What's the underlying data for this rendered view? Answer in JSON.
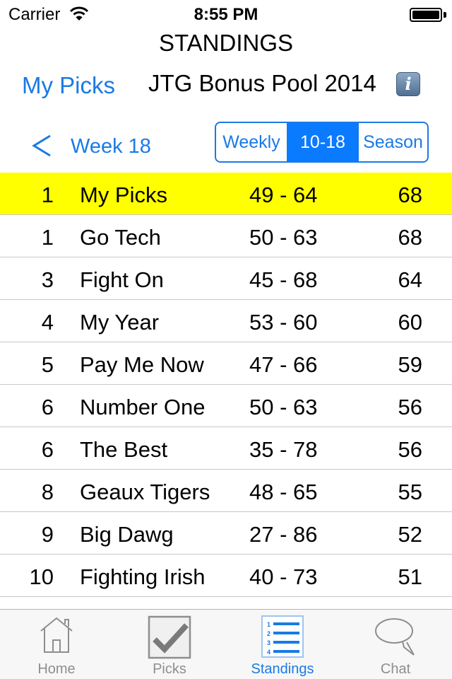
{
  "status_bar": {
    "carrier": "Carrier",
    "time": "8:55 PM",
    "wifi_icon": "wifi-icon",
    "battery_icon": "battery-full-icon"
  },
  "header": {
    "title": "STANDINGS",
    "my_picks_label": "My Picks",
    "pool_name": "JTG Bonus Pool 2014",
    "info_icon": "info-icon"
  },
  "week_nav": {
    "back_icon": "chevron-left-icon",
    "week_label": "Week 18"
  },
  "segmented_control": {
    "segments": [
      {
        "label": "Weekly",
        "selected": false
      },
      {
        "label": "10-18",
        "selected": true
      },
      {
        "label": "Season",
        "selected": false
      }
    ]
  },
  "colors": {
    "accent": "#1a7ae6",
    "selected_segment": "#0a7aff",
    "highlight_row": "#ffff00",
    "separator": "#c8c8c8"
  },
  "standings": [
    {
      "rank": "1",
      "name": "My Picks",
      "record": "49 - 64",
      "points": "68",
      "highlight": true
    },
    {
      "rank": "1",
      "name": "Go Tech",
      "record": "50 - 63",
      "points": "68",
      "highlight": false
    },
    {
      "rank": "3",
      "name": "Fight On",
      "record": "45 - 68",
      "points": "64",
      "highlight": false
    },
    {
      "rank": "4",
      "name": "My Year",
      "record": "53 - 60",
      "points": "60",
      "highlight": false
    },
    {
      "rank": "5",
      "name": "Pay Me Now",
      "record": "47 - 66",
      "points": "59",
      "highlight": false
    },
    {
      "rank": "6",
      "name": "Number One",
      "record": "50 - 63",
      "points": "56",
      "highlight": false
    },
    {
      "rank": "6",
      "name": "The Best",
      "record": "35 - 78",
      "points": "56",
      "highlight": false
    },
    {
      "rank": "8",
      "name": "Geaux Tigers",
      "record": "48 - 65",
      "points": "55",
      "highlight": false
    },
    {
      "rank": "9",
      "name": "Big Dawg",
      "record": "27 - 86",
      "points": "52",
      "highlight": false
    },
    {
      "rank": "10",
      "name": "Fighting Irish",
      "record": "40 - 73",
      "points": "51",
      "highlight": false
    }
  ],
  "tab_bar": {
    "tabs": [
      {
        "label": "Home",
        "icon": "house-icon",
        "active": false
      },
      {
        "label": "Picks",
        "icon": "checkbox-icon",
        "active": false
      },
      {
        "label": "Standings",
        "icon": "numbered-list-icon",
        "active": true
      },
      {
        "label": "Chat",
        "icon": "speech-bubble-icon",
        "active": false
      }
    ]
  }
}
